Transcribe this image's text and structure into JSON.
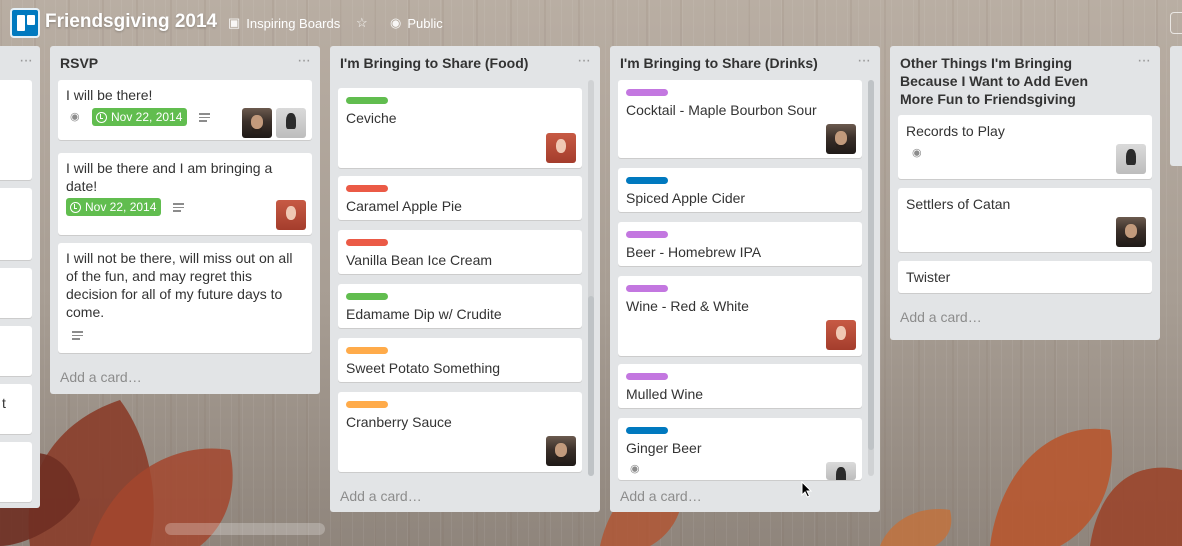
{
  "header": {
    "board_title": "Friendsgiving 2014",
    "team_label": "Inspiring Boards",
    "visibility_label": "Public"
  },
  "lists": [
    {
      "title": "RSVP",
      "add_card": "Add a card…",
      "cards": [
        {
          "title": "I will be there!",
          "due": "Nov 22, 2014"
        },
        {
          "title": "I will be there and I am bringing a date!",
          "due": "Nov 22, 2014"
        },
        {
          "title": "I will not be there, will miss out on all of the fun, and may regret this decision for all of my future days to come."
        }
      ]
    },
    {
      "title": "I'm Bringing to Share (Food)",
      "add_card": "Add a card…",
      "cards": [
        {
          "title": "Ceviche",
          "label_color": "#61bd4f"
        },
        {
          "title": "Caramel Apple Pie",
          "label_color": "#eb5a46"
        },
        {
          "title": "Vanilla Bean Ice Cream",
          "label_color": "#eb5a46"
        },
        {
          "title": "Edamame Dip w/ Crudite",
          "label_color": "#61bd4f"
        },
        {
          "title": "Sweet Potato Something",
          "label_color": "#ffab4a"
        },
        {
          "title": "Cranberry Sauce",
          "label_color": "#ffab4a"
        }
      ]
    },
    {
      "title": "I'm Bringing to Share (Drinks)",
      "add_card": "Add a card…",
      "cards": [
        {
          "title": "Cocktail - Maple Bourbon Sour",
          "label_color": "#c377e0"
        },
        {
          "title": "Spiced Apple Cider",
          "label_color": "#0079bf"
        },
        {
          "title": "Beer - Homebrew IPA",
          "label_color": "#c377e0"
        },
        {
          "title": "Wine - Red & White",
          "label_color": "#c377e0"
        },
        {
          "title": "Mulled Wine",
          "label_color": "#c377e0"
        },
        {
          "title": "Ginger Beer",
          "label_color": "#0079bf"
        }
      ]
    },
    {
      "title": "Other Things I'm Bringing Because I Want to Add Even More Fun to Friendsgiving",
      "add_card": "Add a card…",
      "cards": [
        {
          "title": "Records to Play"
        },
        {
          "title": "Settlers of Catan"
        },
        {
          "title": "Twister"
        }
      ]
    }
  ],
  "left_list_fragment_text": "t",
  "colors": {
    "list_bg": "#e2e4e6",
    "due_green": "#61bd4f",
    "brand_blue": "#0079bf"
  }
}
